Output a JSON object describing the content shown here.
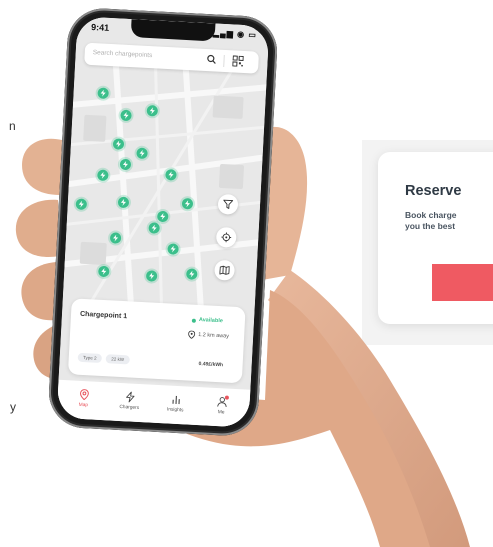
{
  "status_bar": {
    "time": "9:41",
    "icons": "▂▄▆ ◉ ▭"
  },
  "search": {
    "placeholder": "Search chargepoints"
  },
  "map": {
    "pin_count": 18,
    "pin_color": "#3bbf8b"
  },
  "card": {
    "title": "Chargepoint 1",
    "status": "Available",
    "distance": "1.2 km away",
    "chips": [
      "Type 2",
      "22 kW"
    ],
    "price": "0.49£/kWh"
  },
  "tabs": [
    {
      "label": "Map",
      "icon": "map-pin-icon",
      "active": true
    },
    {
      "label": "Chargers",
      "icon": "lightning-icon",
      "active": false
    },
    {
      "label": "Insights",
      "icon": "bar-chart-icon",
      "active": false
    },
    {
      "label": "Me",
      "icon": "user-icon",
      "active": false
    }
  ],
  "promo": {
    "title": "Reserve",
    "line1": "Book charge",
    "line2": "you the best",
    "button_color": "#ef5a62"
  },
  "edge_letters": [
    "n",
    "y"
  ],
  "colors": {
    "accent": "#e8555e",
    "available": "#3bbf8b"
  }
}
